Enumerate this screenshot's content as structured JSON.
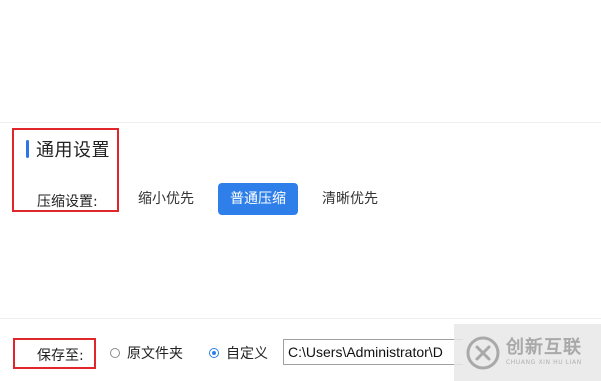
{
  "general": {
    "title": "通用设置",
    "compress_label": "压缩设置:",
    "options": [
      "缩小优先",
      "普通压缩",
      "清晰优先"
    ],
    "selected_option": "普通压缩"
  },
  "save": {
    "label": "保存至:",
    "radio_options": [
      "原文件夹",
      "自定义"
    ],
    "selected_radio": "自定义",
    "path_value": "C:\\Users\\Administrator\\D"
  },
  "watermark": {
    "brand": "创新互联",
    "sub": "CHUANG XIN HU LIAN"
  },
  "colors": {
    "accent": "#2e7fe9",
    "annotation_red": "#e0262b"
  }
}
